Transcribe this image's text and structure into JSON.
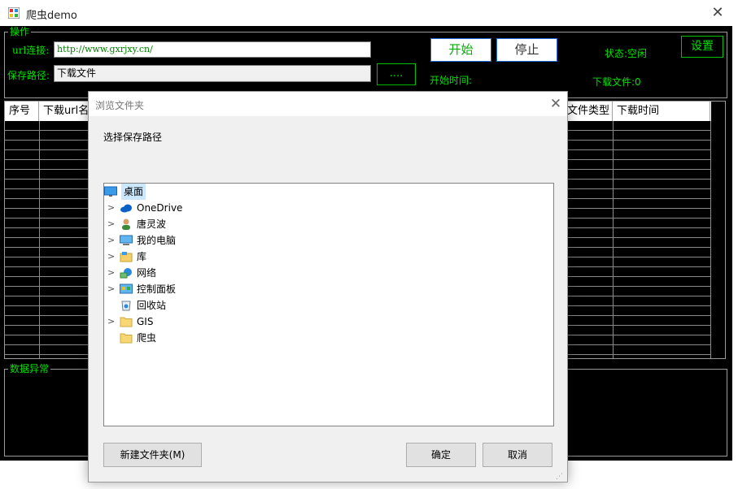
{
  "window": {
    "title": "爬虫demo",
    "close_glyph": "✕"
  },
  "ops": {
    "group_label": "操作",
    "url_label": "url连接:",
    "url_value": "http://www.gxrjxy.cn/",
    "path_label": "保存路径:",
    "path_value": "下载文件",
    "browse_label": "....",
    "start_label": "开始",
    "stop_label": "停止",
    "status_text": "状态:空闲",
    "settings_label": "设置",
    "start_time_label": "开始时间:",
    "download_count_text": "下载文件:0"
  },
  "grid": {
    "columns": [
      "序号",
      "下载url名",
      "文件类型",
      "下载时间"
    ]
  },
  "errors": {
    "group_label": "数据异常"
  },
  "dialog": {
    "title": "浏览文件夹",
    "close_glyph": "✕",
    "description": "选择保存路径",
    "tree": [
      {
        "label": "桌面",
        "icon": "desktop-icon",
        "expandable": false,
        "selected": true
      },
      {
        "label": "OneDrive",
        "icon": "cloud-icon",
        "expandable": true
      },
      {
        "label": "唐灵波",
        "icon": "user-icon",
        "expandable": true
      },
      {
        "label": "我的电脑",
        "icon": "computer-icon",
        "expandable": true
      },
      {
        "label": "库",
        "icon": "library-icon",
        "expandable": true
      },
      {
        "label": "网络",
        "icon": "network-icon",
        "expandable": true
      },
      {
        "label": "控制面板",
        "icon": "control-panel-icon",
        "expandable": true
      },
      {
        "label": "回收站",
        "icon": "recycle-bin-icon",
        "expandable": false
      },
      {
        "label": "GIS",
        "icon": "folder-icon",
        "expandable": true
      },
      {
        "label": "爬虫",
        "icon": "folder-icon",
        "expandable": false
      }
    ],
    "new_folder_label": "新建文件夹(M)",
    "ok_label": "确定",
    "cancel_label": "取消"
  },
  "colors": {
    "accent_green": "#00e000",
    "button_border_blue": "#1e6ad6"
  }
}
